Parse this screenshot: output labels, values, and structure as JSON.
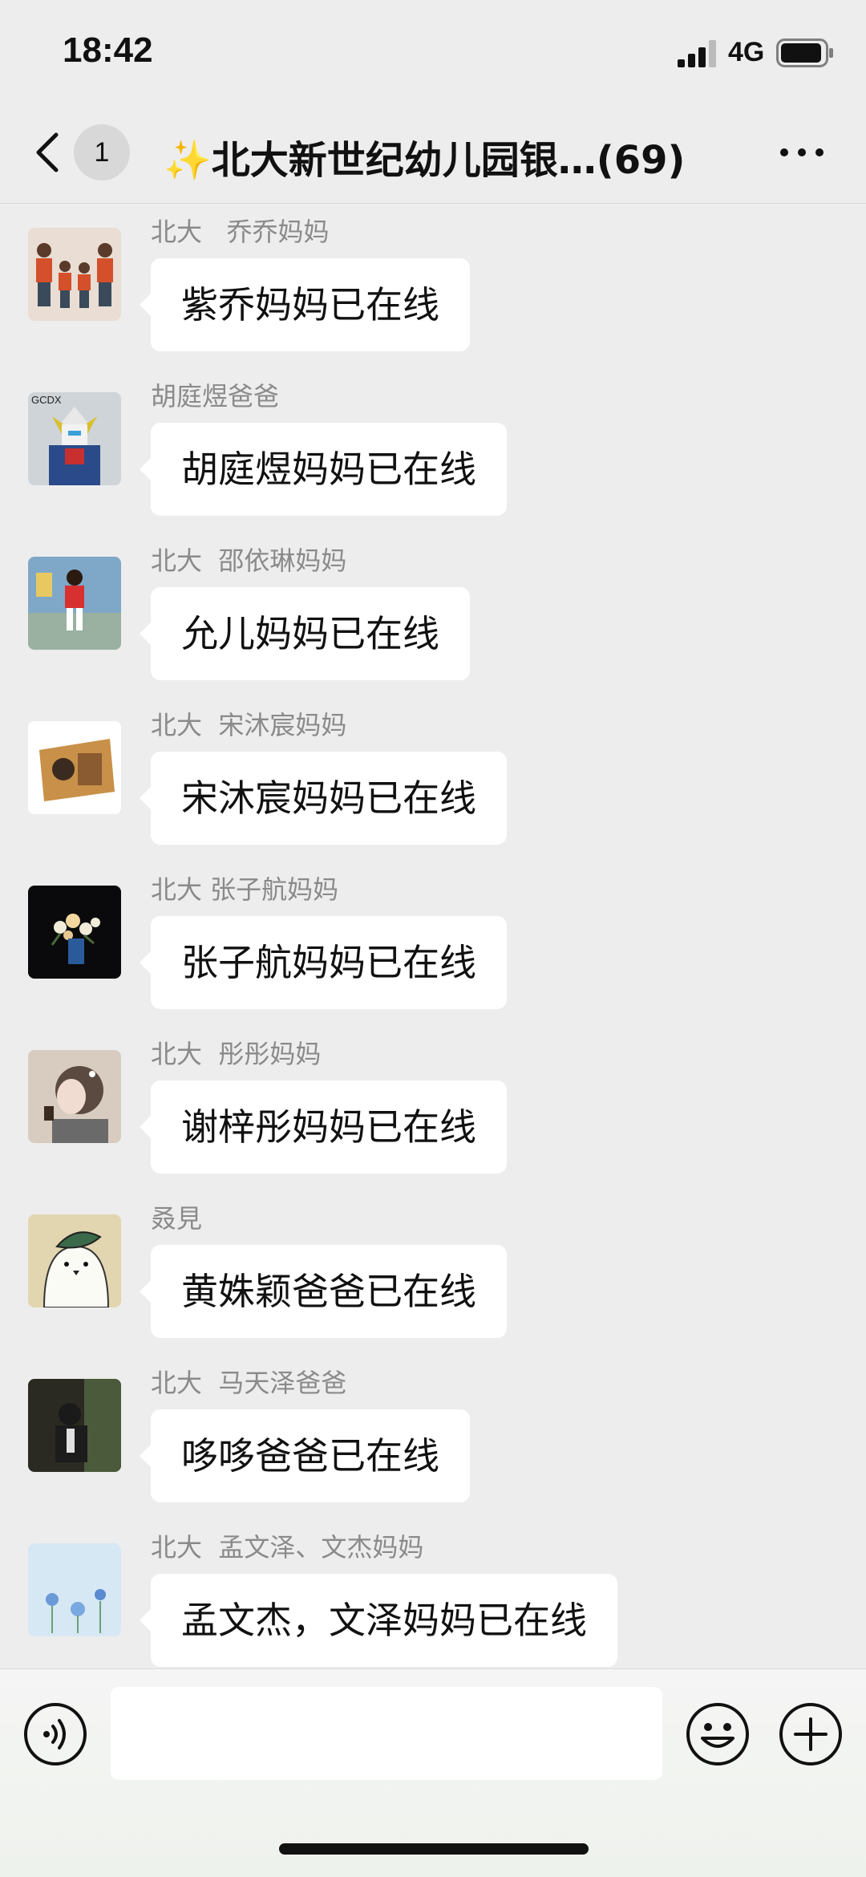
{
  "status_bar": {
    "time": "18:42",
    "network": "4G"
  },
  "header": {
    "unread_count": "1",
    "title_sparkle": "✨",
    "title": "北大新世纪幼儿园银…",
    "member_count": "(69)"
  },
  "messages": [
    {
      "sender": "北大   乔乔妈妈",
      "text": "紫乔妈妈已在线",
      "avatar": "family-photo"
    },
    {
      "sender": "胡庭煜爸爸",
      "text": "胡庭煜妈妈已在线",
      "avatar": "robot-figure",
      "avatar_text": "GCDX"
    },
    {
      "sender": "北大  邵依琳妈妈",
      "text": "允儿妈妈已在线",
      "avatar": "child-photo"
    },
    {
      "sender": "北大  宋沐宸妈妈",
      "text": "宋沐宸妈妈已在线",
      "avatar": "child-photo-tilted"
    },
    {
      "sender": "北大 张子航妈妈",
      "text": "张子航妈妈已在线",
      "avatar": "flowers-dark"
    },
    {
      "sender": "北大  彤彤妈妈",
      "text": "谢梓彤妈妈已在线",
      "avatar": "girl-portrait"
    },
    {
      "sender": "叒見",
      "text": "黄姝颖爸爸已在线",
      "avatar": "cartoon-bird"
    },
    {
      "sender": "北大  马天泽爸爸",
      "text": "哆哆爸爸已在线",
      "avatar": "child-dark"
    },
    {
      "sender": "北大  孟文泽、文杰妈妈",
      "text": "孟文杰，文泽妈妈已在线",
      "avatar": "blue-flowers"
    }
  ],
  "input": {
    "placeholder": ""
  },
  "colors": {
    "background": "#ededed",
    "bubble": "#ffffff",
    "sender": "#8a8a8a"
  }
}
